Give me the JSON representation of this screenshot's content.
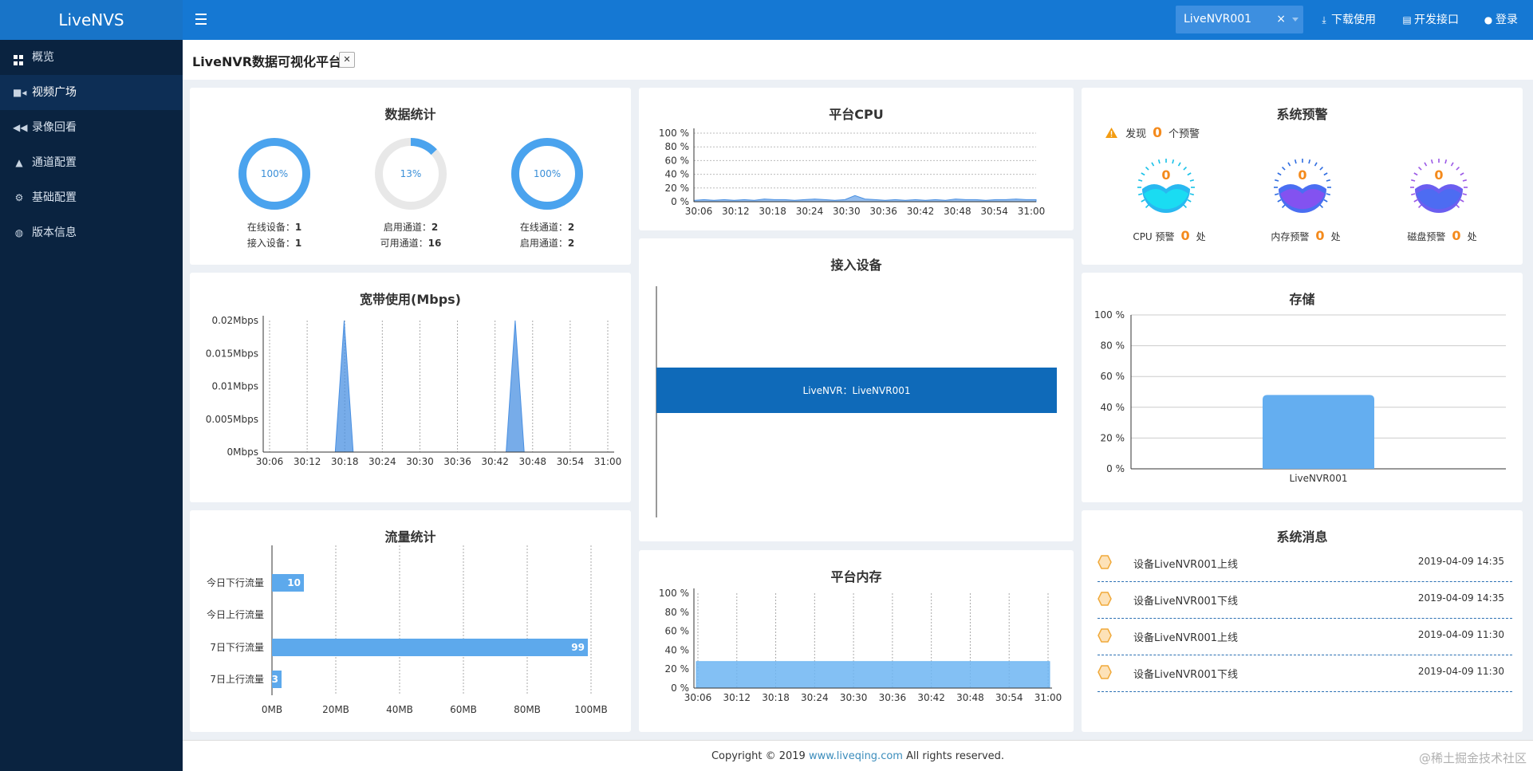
{
  "app": {
    "logo": "LiveNVS"
  },
  "header": {
    "device_select": "LiveNVR001",
    "download_label": "下载使用",
    "api_label": "开发接口",
    "login_label": "登录"
  },
  "sidebar": {
    "items": [
      {
        "label": "概览",
        "icon": "dashboard-icon",
        "active": false
      },
      {
        "label": "视频广场",
        "icon": "video-icon",
        "active": true
      },
      {
        "label": "录像回看",
        "icon": "rewind-icon",
        "active": false
      },
      {
        "label": "通道配置",
        "icon": "road-icon",
        "active": false
      },
      {
        "label": "基础配置",
        "icon": "cogs-icon",
        "active": false
      },
      {
        "label": "版本信息",
        "icon": "globe-icon",
        "active": false
      }
    ]
  },
  "page": {
    "title": "LiveNVR数据可视化平台"
  },
  "stats": {
    "title": "数据统计",
    "rings": [
      {
        "percent": "100%",
        "value": 1.0,
        "line1_label": "在线设备：",
        "line1_value": "1",
        "line2_label": "接入设备：",
        "line2_value": "1"
      },
      {
        "percent": "13%",
        "value": 0.13,
        "line1_label": "启用通道：",
        "line1_value": "2",
        "line2_label": "可用通道：",
        "line2_value": "16"
      },
      {
        "percent": "100%",
        "value": 1.0,
        "line1_label": "在线通道：",
        "line1_value": "2",
        "line2_label": "启用通道：",
        "line2_value": "2"
      }
    ]
  },
  "cpu": {
    "title": "平台CPU"
  },
  "alerts": {
    "title": "系统预警",
    "found_prefix": "发现",
    "found_count": "0",
    "found_suffix": "个预警",
    "gauges": [
      {
        "label": "CPU 预警",
        "count": "0",
        "unit": "处",
        "value": "0"
      },
      {
        "label": "内存预警",
        "count": "0",
        "unit": "处",
        "value": "0"
      },
      {
        "label": "磁盘预警",
        "count": "0",
        "unit": "处",
        "value": "0"
      }
    ],
    "colors": {
      "warn": "#f48a1c"
    }
  },
  "bandwidth": {
    "title": "宽带使用(Mbps)"
  },
  "devices": {
    "title": "接入设备"
  },
  "storage": {
    "title": "存储"
  },
  "traffic": {
    "title": "流量统计"
  },
  "memory": {
    "title": "平台内存"
  },
  "messages": {
    "title": "系统消息",
    "items": [
      {
        "text": "设备LiveNVR001上线",
        "time": "2019-04-09 14:35"
      },
      {
        "text": "设备LiveNVR001下线",
        "time": "2019-04-09 14:35"
      },
      {
        "text": "设备LiveNVR001上线",
        "time": "2019-04-09 11:30"
      },
      {
        "text": "设备LiveNVR001下线",
        "time": "2019-04-09 11:30"
      }
    ]
  },
  "footer": {
    "prefix": "Copyright © 2019 ",
    "link": "www.liveqing.com",
    "suffix": " All rights reserved."
  },
  "watermark": "@稀土掘金技术社区",
  "chart_data": [
    {
      "id": "cpu",
      "type": "area",
      "title": "平台CPU",
      "x": [
        "30:06",
        "30:12",
        "30:18",
        "30:24",
        "30:30",
        "30:36",
        "30:42",
        "30:48",
        "30:54",
        "31:00"
      ],
      "y_ticks": [
        "0 %",
        "20 %",
        "40 %",
        "60 %",
        "80 %",
        "100 %"
      ],
      "ylim": [
        0,
        100
      ],
      "series": [
        {
          "values": [
            2,
            3,
            2,
            3,
            2,
            3,
            2,
            4,
            3,
            3,
            2,
            3,
            4,
            3,
            2,
            3,
            9,
            4,
            3,
            2,
            3,
            2,
            3,
            2,
            3,
            2,
            4,
            3,
            3,
            2,
            3,
            3,
            4,
            3,
            3
          ]
        }
      ],
      "color": "#4a90e2"
    },
    {
      "id": "bandwidth",
      "type": "area",
      "title": "宽带使用(Mbps)",
      "x": [
        "30:06",
        "30:12",
        "30:18",
        "30:24",
        "30:30",
        "30:36",
        "30:42",
        "30:48",
        "30:54",
        "31:00"
      ],
      "y_ticks": [
        "0Mbps",
        "0.005Mbps",
        "0.01Mbps",
        "0.015Mbps",
        "0.02Mbps"
      ],
      "ylim": [
        0,
        0.02
      ],
      "series": [
        {
          "values": [
            0,
            0,
            0,
            0,
            0,
            0,
            0,
            0,
            0,
            0.02,
            0,
            0,
            0,
            0,
            0,
            0,
            0,
            0,
            0,
            0,
            0,
            0,
            0,
            0,
            0,
            0,
            0,
            0,
            0.02,
            0,
            0,
            0,
            0,
            0,
            0,
            0,
            0,
            0,
            0,
            0
          ]
        }
      ],
      "color": "#4a90e2"
    },
    {
      "id": "devices",
      "type": "bar",
      "orientation": "horizontal",
      "title": "接入设备",
      "categories": [
        "LiveNVR"
      ],
      "data_label": "LiveNVR：LiveNVR001",
      "values": [
        1
      ],
      "color": "#0f6ab9"
    },
    {
      "id": "storage",
      "type": "bar",
      "title": "存储",
      "categories": [
        "LiveNVR001"
      ],
      "values": [
        48
      ],
      "y_ticks": [
        "0 %",
        "20 %",
        "40 %",
        "60 %",
        "80 %",
        "100 %"
      ],
      "ylim": [
        0,
        100
      ],
      "color": "#64aef0"
    },
    {
      "id": "traffic",
      "type": "bar",
      "orientation": "horizontal",
      "title": "流量统计",
      "categories": [
        "今日下行流量",
        "今日上行流量",
        "7日下行流量",
        "7日上行流量"
      ],
      "values": [
        10,
        0,
        99,
        3
      ],
      "data_labels": [
        "10",
        "",
        "99",
        "3"
      ],
      "x_ticks": [
        "0MB",
        "20MB",
        "40MB",
        "60MB",
        "80MB",
        "100MB"
      ],
      "xlim": [
        0,
        100
      ],
      "color": "#5da9ec"
    },
    {
      "id": "memory",
      "type": "area",
      "title": "平台内存",
      "x": [
        "30:06",
        "30:12",
        "30:18",
        "30:24",
        "30:30",
        "30:36",
        "30:42",
        "30:48",
        "30:54",
        "31:00"
      ],
      "y_ticks": [
        "0 %",
        "20 %",
        "40 %",
        "60 %",
        "80 %",
        "100 %"
      ],
      "ylim": [
        0,
        100
      ],
      "series": [
        {
          "values": [
            28,
            28,
            28,
            28,
            28,
            28,
            28,
            28,
            28,
            28,
            28
          ]
        }
      ],
      "color": "#6db5f2"
    }
  ]
}
